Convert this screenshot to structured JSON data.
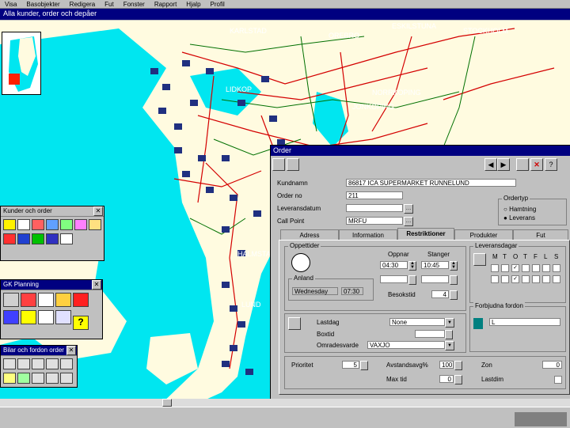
{
  "menu": [
    "Visa",
    "Basobjekter",
    "Redigera",
    "Fut",
    "Fonster",
    "Rapport",
    "Hjalp",
    "Profil"
  ],
  "window_title": "Alla kunder, order och depåer",
  "map_labels": [
    "KARLSTAD",
    "OREBRO",
    "ESKILSTUNA",
    "STOCKHOLM",
    "LIDKOP",
    "NORRKOPING",
    "JONKOPING",
    "HALMSTAD",
    "LUND"
  ],
  "palettes": {
    "orders": {
      "title": "Kunder och order"
    },
    "planning": {
      "title": "GK Planning"
    },
    "vehicles": {
      "title": "Bilar och fordon order"
    }
  },
  "order": {
    "title": "Order",
    "kundnamn_label": "Kundnamn",
    "kundnamn": "86817 ICA SUPERMARKET RUNNELUND",
    "ordernr_label": "Order no",
    "ordernr": "211",
    "lev_label": "Leveransdatum",
    "lev": "",
    "cal_label": "Call Point",
    "cal": "MRFU",
    "ordertyp_label": "Ordertyp",
    "radio1": "Hamtning",
    "radio2": "Leverans",
    "tabs": [
      "Adress",
      "Information",
      "Restriktioner",
      "Produkter",
      "Fut"
    ],
    "oppettider_label": "Oppettider",
    "oppnar_label": "Oppnar",
    "stanger_label": "Stanger",
    "oppnar": "04:30",
    "stanger": "10:45",
    "anland_label": "Anland",
    "anland_day": "Wednesday",
    "anland_time": "07:30",
    "besokstid_label": "Besokstid",
    "besokstid": "4",
    "dagar_label": "Leveransdagar",
    "days": [
      "M",
      "T",
      "O",
      "T",
      "F",
      "L",
      "S"
    ],
    "forbjudna_label": "Forbjudna fordon",
    "forbjudna": "L",
    "lastdag_label": "Lastdag",
    "lastdag": "None",
    "boxtid_label": "Boxtid",
    "omr_label": "Omradesvarde",
    "omr": "VAXJO",
    "prio_label": "Prioritet",
    "prio": "5",
    "avst_label": "Avstandsavg%",
    "avst": "100",
    "zon_label": "Zon",
    "zon": "0",
    "maxtid_label": "Max tid",
    "maxtid": "0",
    "lotdim_label": "Lastdim"
  }
}
